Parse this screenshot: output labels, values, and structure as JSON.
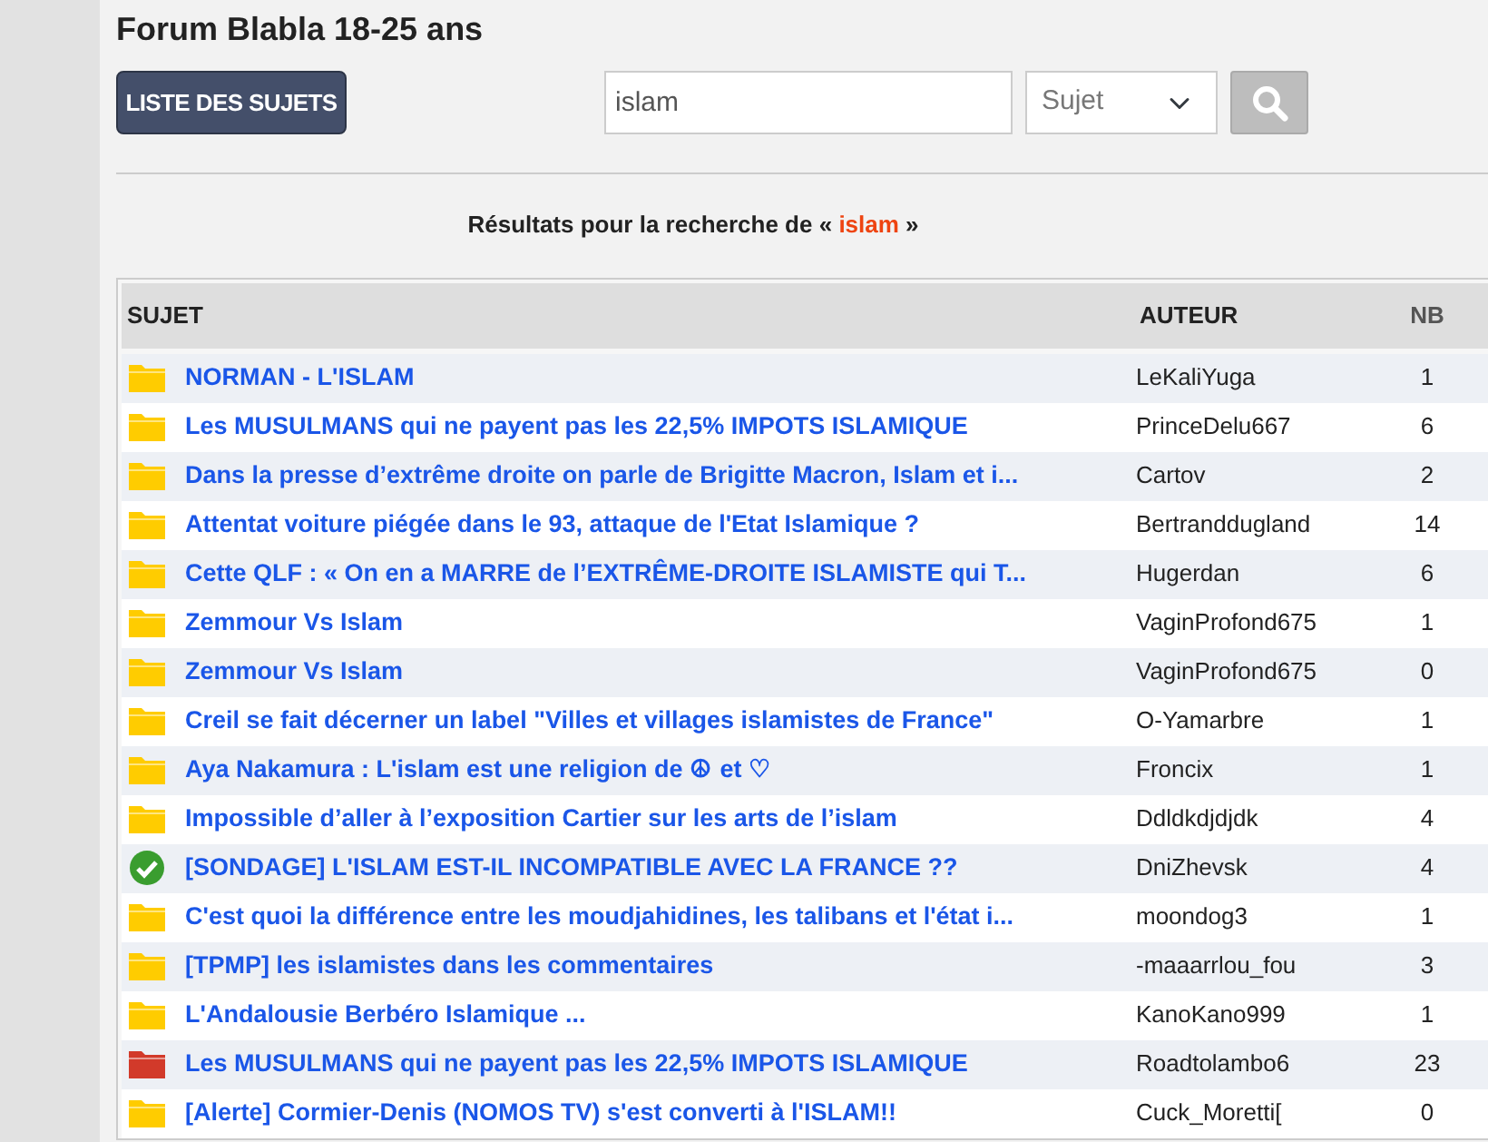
{
  "page_title": "Forum Blabla 18-25 ans",
  "list_button": "LISTE DES SUJETS",
  "search": {
    "value": "islam",
    "scope": "Sujet"
  },
  "results": {
    "prefix": "Résultats pour la recherche de « ",
    "term": "islam",
    "suffix": " »"
  },
  "table": {
    "columns": [
      "SUJET",
      "AUTEUR",
      "NB"
    ],
    "rows": [
      {
        "kind": "folder",
        "subject": "NORMAN - L'ISLAM",
        "author": "LeKaliYuga",
        "count": "1"
      },
      {
        "kind": "folder",
        "subject": "Les MUSULMANS qui ne payent pas les 22,5% IMPOTS ISLAMIQUE",
        "author": "PrinceDelu667",
        "count": "6"
      },
      {
        "kind": "folder",
        "subject": "Dans la presse d’extrême droite on parle de Brigitte Macron, Islam et i...",
        "author": "Cartov",
        "count": "2"
      },
      {
        "kind": "folder",
        "subject": "Attentat voiture piégée dans le 93, attaque de l'Etat Islamique ?",
        "author": "Bertranddugland",
        "count": "14"
      },
      {
        "kind": "folder",
        "subject": "Cette QLF : « On en a MARRE de l’EXTRÊME-DROITE ISLAMISTE qui T...",
        "author": "Hugerdan",
        "count": "6"
      },
      {
        "kind": "folder",
        "subject": "Zemmour Vs Islam",
        "author": "VaginProfond675",
        "count": "1"
      },
      {
        "kind": "folder",
        "subject": "Zemmour Vs Islam",
        "author": "VaginProfond675",
        "count": "0"
      },
      {
        "kind": "folder",
        "subject": "Creil se fait décerner un label \"Villes et villages islamistes de France\"",
        "author": "O-Yamarbre",
        "count": "1"
      },
      {
        "kind": "folder",
        "subject": "Aya Nakamura : L'islam est une religion de ☮ et ♡",
        "author": "Froncix",
        "count": "1"
      },
      {
        "kind": "folder",
        "subject": "Impossible d’aller à l’exposition Cartier sur les arts de l’islam",
        "author": "Ddldkdjdjdk",
        "count": "4"
      },
      {
        "kind": "resolved",
        "subject": "[SONDAGE] L'ISLAM EST-IL INCOMPATIBLE AVEC LA FRANCE ??",
        "author": "DniZhevsk",
        "count": "4"
      },
      {
        "kind": "folder",
        "subject": "C'est quoi la différence entre les moudjahidines, les talibans et l'état i...",
        "author": "moondog3",
        "count": "1"
      },
      {
        "kind": "folder",
        "subject": "[TPMP] les islamistes dans les commentaires",
        "author": "-maaarrlou_fou",
        "count": "3"
      },
      {
        "kind": "folder",
        "subject": "L'Andalousie Berbéro Islamique ...",
        "author": "KanoKano999",
        "count": "1"
      },
      {
        "kind": "hot",
        "subject": "Les MUSULMANS qui ne payent pas les 22,5% IMPOTS ISLAMIQUE",
        "author": "Roadtolambo6",
        "count": "23"
      },
      {
        "kind": "folder",
        "subject": "[Alerte] Cormier-Denis (NOMOS TV) s'est converti à l'ISLAM!!",
        "author": "Cuck_Moretti[",
        "count": "0"
      }
    ]
  }
}
